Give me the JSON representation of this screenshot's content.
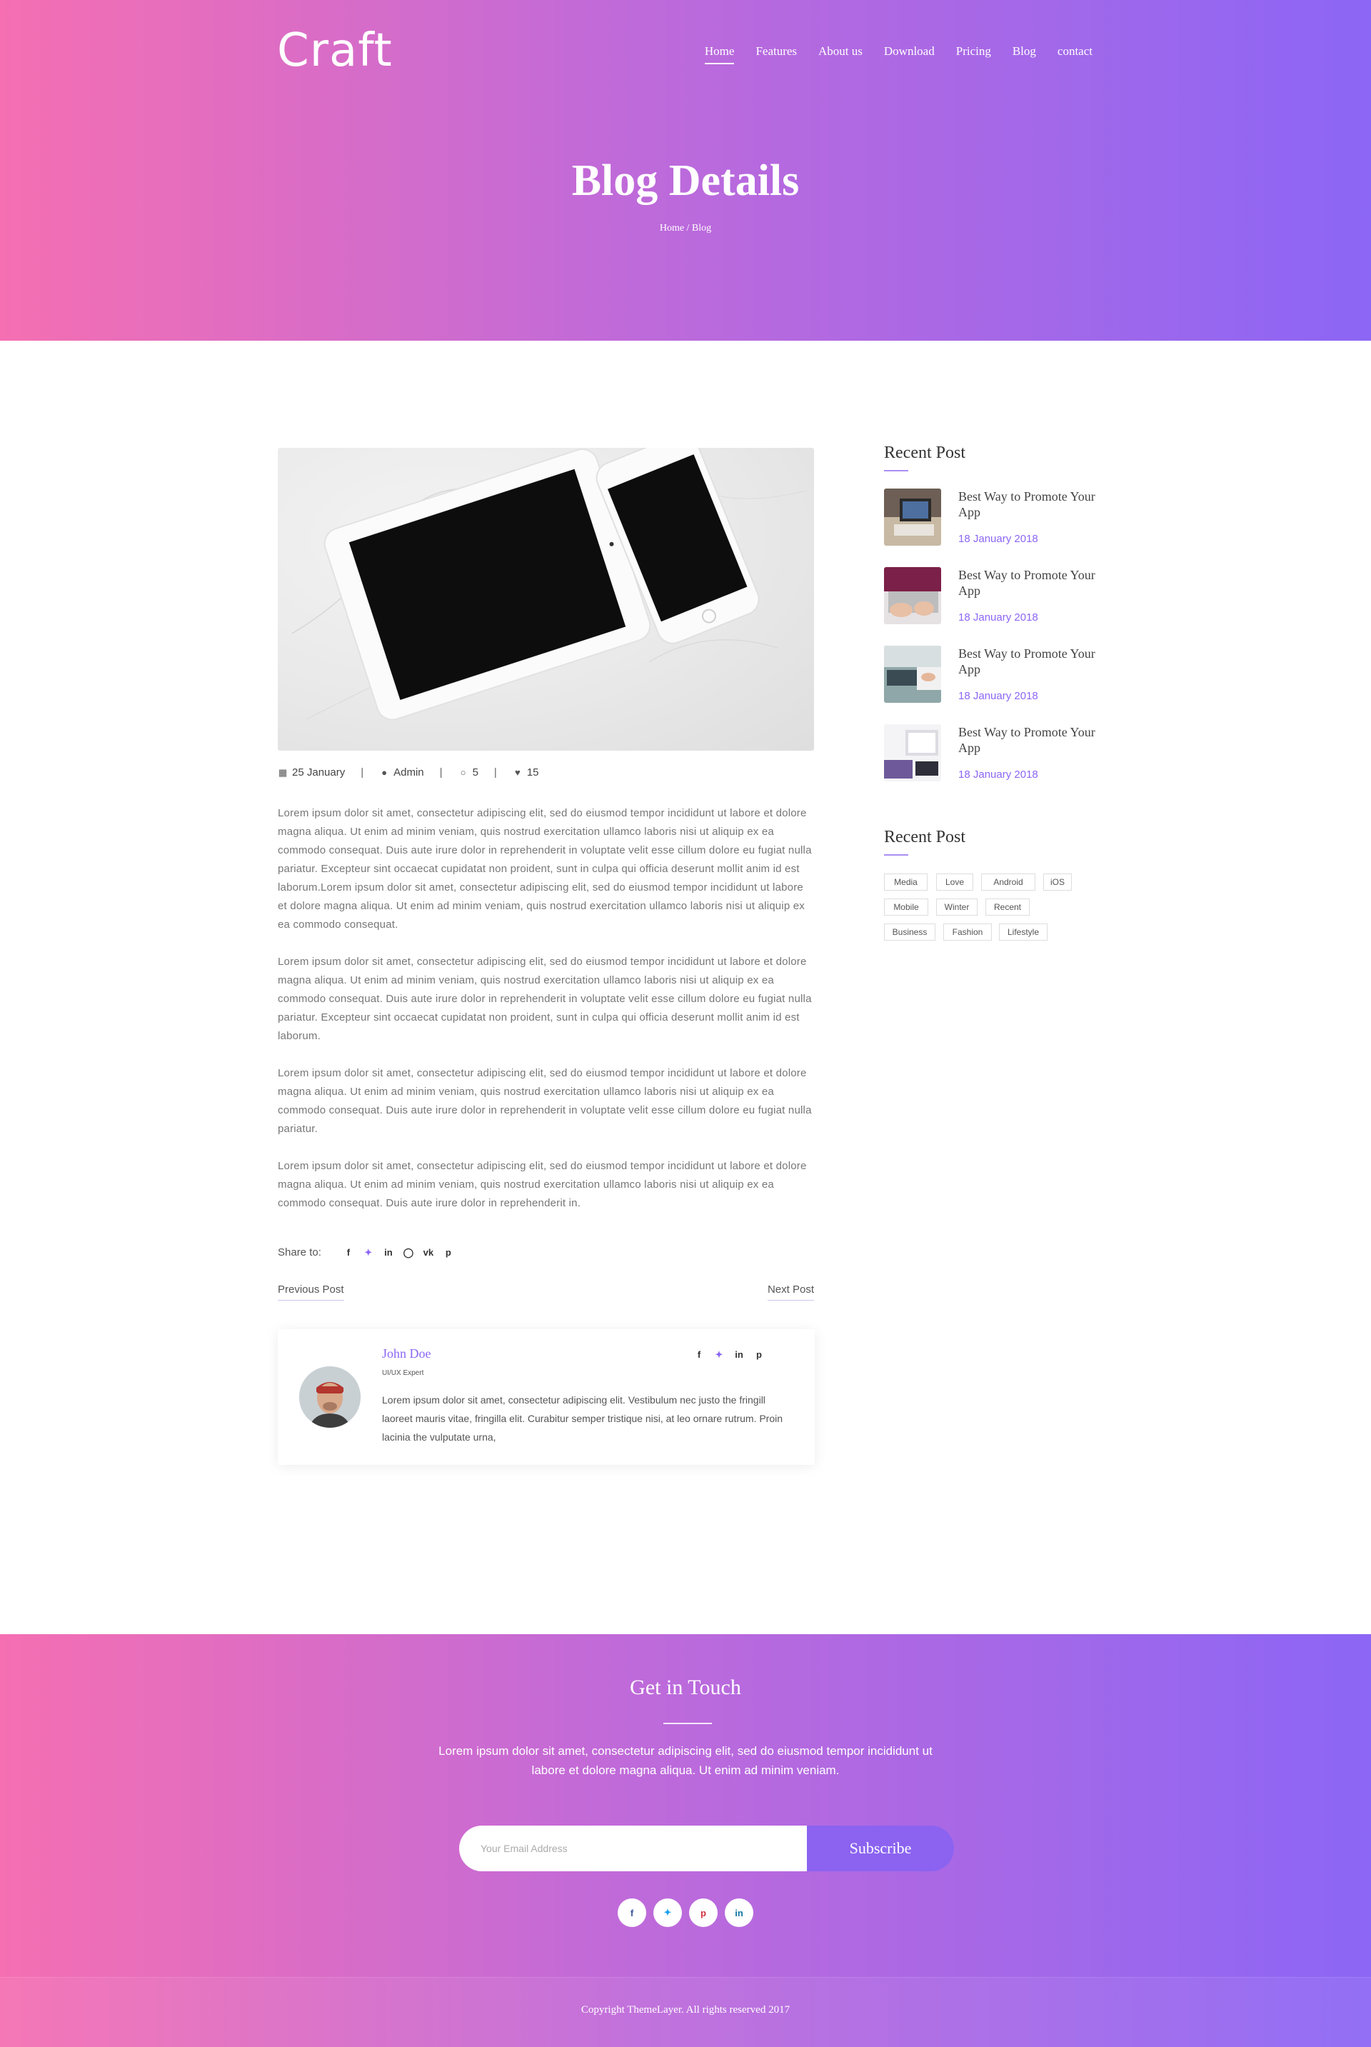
{
  "brand": {
    "logo": "Craft"
  },
  "nav": {
    "items": [
      "Home",
      "Features",
      "About us",
      "Download",
      "Pricing",
      "Blog",
      "contact"
    ],
    "active": "Home"
  },
  "hero": {
    "title": "Blog Details",
    "breadcrumb": "Home / Blog"
  },
  "post": {
    "meta": {
      "date": "25 January",
      "author": "Admin",
      "comments": "5",
      "likes": "15"
    },
    "paragraphs": [
      "Lorem ipsum dolor sit amet, consectetur adipiscing elit, sed do eiusmod tempor incididunt ut labore et dolore magna aliqua. Ut enim ad minim veniam, quis nostrud exercitation ullamco laboris nisi ut aliquip ex ea commodo consequat. Duis aute irure dolor in reprehenderit in voluptate velit esse cillum dolore eu fugiat nulla pariatur. Excepteur sint occaecat cupidatat non proident, sunt in culpa qui officia deserunt mollit anim id est laborum.Lorem ipsum dolor sit amet, consectetur adipiscing elit, sed do eiusmod tempor incididunt ut labore et dolore magna aliqua. Ut enim ad minim veniam, quis nostrud exercitation ullamco laboris nisi ut aliquip ex ea commodo consequat.",
      "Lorem ipsum dolor sit amet, consectetur adipiscing elit, sed do eiusmod tempor incididunt ut labore et dolore magna aliqua. Ut enim ad minim veniam, quis nostrud exercitation ullamco laboris nisi ut aliquip ex ea commodo consequat. Duis aute irure dolor in reprehenderit in voluptate velit esse cillum dolore eu fugiat nulla pariatur. Excepteur sint occaecat cupidatat non proident, sunt in culpa qui officia deserunt mollit anim id est laborum.",
      "Lorem ipsum dolor sit amet, consectetur adipiscing elit, sed do eiusmod tempor incididunt ut labore et dolore magna aliqua. Ut enim ad minim veniam, quis nostrud exercitation ullamco laboris nisi ut aliquip ex ea commodo consequat. Duis aute irure dolor in reprehenderit in voluptate velit esse cillum dolore eu fugiat nulla pariatur.",
      "Lorem ipsum dolor sit amet, consectetur adipiscing elit, sed do eiusmod tempor incididunt ut labore et dolore magna aliqua. Ut enim ad minim veniam, quis nostrud exercitation ullamco laboris nisi ut aliquip ex ea commodo consequat. Duis aute irure dolor in reprehenderit in."
    ],
    "share_label": "Share to:",
    "share_icons": [
      "facebook-icon",
      "twitter-icon",
      "linkedin-icon",
      "instagram-icon",
      "vk-icon",
      "pinterest-icon"
    ],
    "prev_label": "Previous Post",
    "next_label": "Next Post"
  },
  "author": {
    "name": "John Doe",
    "role": "UI/UX Expert",
    "bio": "Lorem ipsum dolor sit amet, consectetur adipiscing elit. Vestibulum nec justo the fringill laoreet mauris vitae, fringilla elit. Curabitur semper tristique nisi, at leo ornare rutrum. Proin lacinia the vulputate urna,",
    "social": [
      "facebook-icon",
      "twitter-icon",
      "linkedin-icon",
      "pinterest-icon"
    ]
  },
  "sidebar": {
    "recent_title": "Recent Post",
    "recent_posts": [
      {
        "title": "Best Way to Promote Your App",
        "date": "18 January 2018"
      },
      {
        "title": "Best Way to Promote Your App",
        "date": "18 January 2018"
      },
      {
        "title": "Best Way to Promote Your App",
        "date": "18 January 2018"
      },
      {
        "title": "Best Way to Promote Your App",
        "date": "18 January 2018"
      }
    ],
    "tags_title": "Recent Post",
    "tags": [
      "Media",
      "Love",
      "Android",
      "iOS",
      "Mobile",
      "Winter",
      "Recent",
      "Business",
      "Fashion",
      "Lifestyle"
    ]
  },
  "footer": {
    "title": "Get in Touch",
    "text": "Lorem ipsum dolor sit amet, consectetur adipiscing elit, sed do eiusmod tempor incididunt ut labore et dolore magna aliqua. Ut enim ad minim veniam.",
    "email_placeholder": "Your Email Address",
    "subscribe_label": "Subscribe",
    "social": [
      "facebook-icon",
      "twitter-icon",
      "pinterest-icon",
      "linkedin-icon"
    ],
    "copyright": "Copyright ThemeLayer. All rights reserved 2017"
  },
  "colors": {
    "accent": "#8c66f5",
    "gradient_start": "#f56fb2",
    "gradient_end": "#8c66f5"
  }
}
